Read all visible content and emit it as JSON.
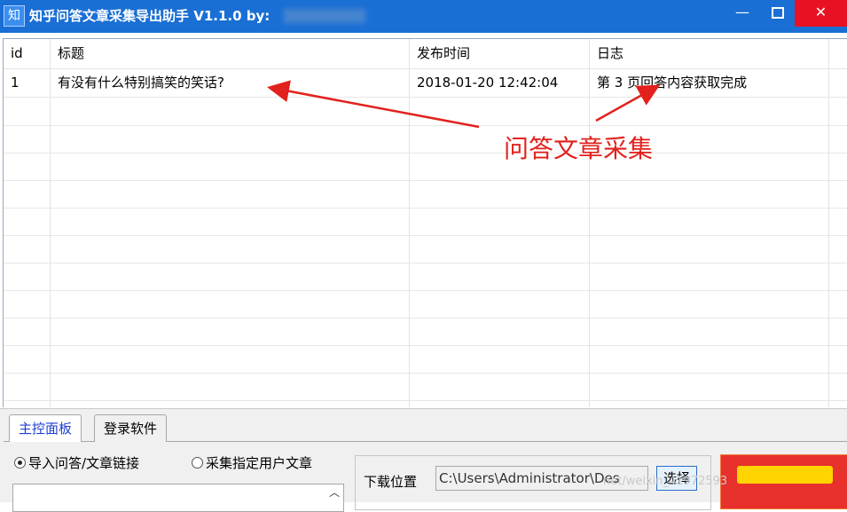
{
  "window": {
    "icon_glyph": "知",
    "title": "知乎问答文章采集导出助手 V1.1.0 by:",
    "controls": {
      "minimize": "—",
      "close": "✕"
    }
  },
  "grid": {
    "columns": [
      "id",
      "标题",
      "发布时间",
      "日志"
    ],
    "rows": [
      {
        "id": "1",
        "title": "有没有什么特别搞笑的笑话?",
        "time": "2018-01-20 12:42:04",
        "log": "第 3 页回答内容获取完成"
      }
    ]
  },
  "annotation": {
    "label": "问答文章采集",
    "color": "#e2211c"
  },
  "panel": {
    "tabs": [
      "主控面板",
      "登录软件"
    ],
    "radios": [
      {
        "label": "导入问答/文章链接",
        "checked": true
      },
      {
        "label": "采集指定用户文章",
        "checked": false
      }
    ],
    "download_label": "下载位置",
    "download_path": "C:\\Users\\Administrator\\Des",
    "choose_label": "选择"
  },
  "watermark": "net/weixin_41972593",
  "colors": {
    "titlebar": "#1a6fd4",
    "close": "#e81123",
    "tab_active_text": "#1a3fd6"
  }
}
